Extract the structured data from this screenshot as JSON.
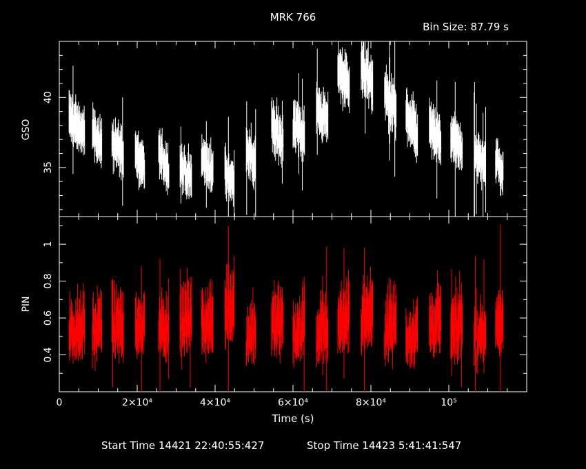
{
  "title": "MRK 766",
  "bin_size": "Bin Size:  87.79  s",
  "footer": {
    "start": "Start Time 14421 22:40:55:427",
    "stop": "Stop Time 14423  5:41:41:547"
  },
  "colors": {
    "background": "#000000",
    "gso": "#ffffff",
    "pin": "#ff0000",
    "axes": "#ffffff"
  },
  "chart_data": [
    {
      "type": "scatter",
      "panel": "top",
      "ylabel": "GSO",
      "xlabel": "",
      "xlim": [
        0,
        120000
      ],
      "ylim": [
        31.5,
        44
      ],
      "yticks": [
        {
          "v": 35,
          "label": "35"
        },
        {
          "v": 40,
          "label": "40"
        }
      ],
      "segments": [
        {
          "x": [
            2500,
            6600
          ],
          "mean": 38.0
        },
        {
          "x": [
            8500,
            11000
          ],
          "mean": 36.9
        },
        {
          "x": [
            13500,
            16500
          ],
          "mean": 36.5
        },
        {
          "x": [
            19500,
            22000
          ],
          "mean": 35.5
        },
        {
          "x": [
            25500,
            28200
          ],
          "mean": 35.4
        },
        {
          "x": [
            31000,
            34000
          ],
          "mean": 34.6
        },
        {
          "x": [
            36500,
            39500
          ],
          "mean": 35.2
        },
        {
          "x": [
            42500,
            45000
          ],
          "mean": 34.3
        },
        {
          "x": [
            48000,
            50500
          ],
          "mean": 35.8
        },
        {
          "x": [
            54500,
            57500
          ],
          "mean": 37.4
        },
        {
          "x": [
            60000,
            63000
          ],
          "mean": 37.8
        },
        {
          "x": [
            66000,
            69000
          ],
          "mean": 38.7
        },
        {
          "x": [
            71500,
            74500
          ],
          "mean": 41.5
        },
        {
          "x": [
            77500,
            80500
          ],
          "mean": 41.6
        },
        {
          "x": [
            83500,
            86500
          ],
          "mean": 39.7
        },
        {
          "x": [
            89000,
            92000
          ],
          "mean": 38.0
        },
        {
          "x": [
            95000,
            98000
          ],
          "mean": 37.3
        },
        {
          "x": [
            100500,
            103500
          ],
          "mean": 36.6
        },
        {
          "x": [
            106500,
            109500
          ],
          "mean": 35.6
        },
        {
          "x": [
            112000,
            114000
          ],
          "mean": 35.1
        }
      ]
    },
    {
      "type": "scatter",
      "panel": "bottom",
      "ylabel": "PIN",
      "xlabel": "Time (s)",
      "xlim": [
        0,
        120000
      ],
      "ylim": [
        0.2,
        1.15
      ],
      "yticks": [
        {
          "v": 0.4,
          "label": "0.4"
        },
        {
          "v": 0.6,
          "label": "0.6"
        },
        {
          "v": 0.8,
          "label": "0.8"
        },
        {
          "v": 1,
          "label": "1"
        }
      ],
      "xticks": [
        {
          "v": 0,
          "label": "0"
        },
        {
          "v": 20000,
          "label": "2×10⁴"
        },
        {
          "v": 40000,
          "label": "4×10⁴"
        },
        {
          "v": 60000,
          "label": "6×10⁴"
        },
        {
          "v": 80000,
          "label": "8×10⁴"
        },
        {
          "v": 100000,
          "label": "10⁵"
        }
      ],
      "segments": [
        {
          "x": [
            2500,
            6600
          ],
          "mean": 0.55
        },
        {
          "x": [
            8500,
            11000
          ],
          "mean": 0.55
        },
        {
          "x": [
            13500,
            16500
          ],
          "mean": 0.55
        },
        {
          "x": [
            19500,
            22000
          ],
          "mean": 0.55
        },
        {
          "x": [
            25500,
            28200
          ],
          "mean": 0.56
        },
        {
          "x": [
            31000,
            34000
          ],
          "mean": 0.58
        },
        {
          "x": [
            36500,
            39500
          ],
          "mean": 0.57
        },
        {
          "x": [
            42500,
            45000
          ],
          "mean": 0.66
        },
        {
          "x": [
            48000,
            50500
          ],
          "mean": 0.52
        },
        {
          "x": [
            54500,
            57500
          ],
          "mean": 0.57
        },
        {
          "x": [
            60000,
            63000
          ],
          "mean": 0.53
        },
        {
          "x": [
            66000,
            69000
          ],
          "mean": 0.53
        },
        {
          "x": [
            71500,
            74500
          ],
          "mean": 0.6
        },
        {
          "x": [
            77500,
            80500
          ],
          "mean": 0.62
        },
        {
          "x": [
            83500,
            86500
          ],
          "mean": 0.57
        },
        {
          "x": [
            89000,
            92000
          ],
          "mean": 0.52
        },
        {
          "x": [
            95000,
            98000
          ],
          "mean": 0.57
        },
        {
          "x": [
            100500,
            103500
          ],
          "mean": 0.56
        },
        {
          "x": [
            106500,
            109500
          ],
          "mean": 0.52
        },
        {
          "x": [
            112000,
            114000
          ],
          "mean": 0.57
        }
      ]
    }
  ]
}
